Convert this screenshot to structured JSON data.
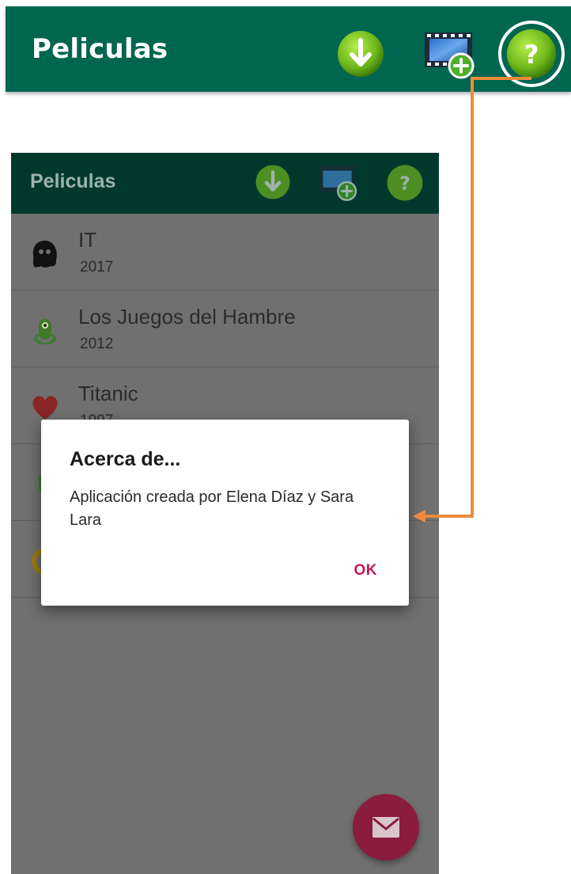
{
  "app": {
    "title": "Peliculas"
  },
  "toolbar": {
    "icons": [
      "download-icon",
      "movie-add-icon",
      "help-icon"
    ]
  },
  "colors": {
    "primary": "#00664f",
    "primary_dimmed": "#00392c",
    "icon_green": "#7cc21c",
    "callout_orange": "#f08a3c",
    "accent_pink": "#c2185b",
    "fab": "#8a1c3e"
  },
  "phone": {
    "title": "Peliculas",
    "movies": [
      {
        "title": "IT",
        "year": "2017",
        "icon": "ghost-icon"
      },
      {
        "title": "Los Juegos del Hambre",
        "year": "2012",
        "icon": "alien-icon"
      },
      {
        "title": "Titanic",
        "year": "1997",
        "icon": "heart-icon"
      },
      {
        "title": "",
        "year": "",
        "icon": "alien-icon"
      },
      {
        "title": "",
        "year": "",
        "icon": "emoji-icon"
      }
    ],
    "fab_icon": "mail-icon"
  },
  "dialog": {
    "title": "Acerca de...",
    "message": "Aplicación creada por Elena Díaz y Sara Lara",
    "ok_label": "OK"
  }
}
